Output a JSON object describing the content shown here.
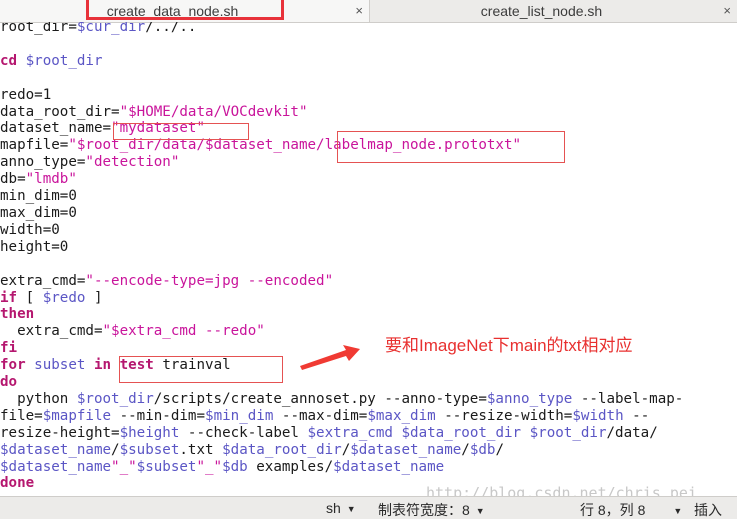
{
  "tabs": [
    {
      "label": "create_data_node.sh",
      "close": "×",
      "active": true
    },
    {
      "label": "create_list_node.sh",
      "close": "×",
      "active": false
    }
  ],
  "code": {
    "l1": {
      "a": "root_dir=",
      "b": "$cur_dir",
      "c": "/../.."
    },
    "l3": {
      "a": "cd ",
      "b": "$root_dir"
    },
    "l5": "redo=1",
    "l6": {
      "a": "data_root_dir=",
      "b": "\"$HOME/data/VOCdevkit\""
    },
    "l7": {
      "a": "dataset_name=",
      "b": "\"mydataset\""
    },
    "l8": {
      "a": "mapfile=",
      "b": "\"$root_dir/data/$dataset_name/labelmap_node.prototxt\""
    },
    "l9": {
      "a": "anno_type=",
      "b": "\"detection\""
    },
    "l10": {
      "a": "db=",
      "b": "\"lmdb\""
    },
    "l11": "min_dim=0",
    "l12": "max_dim=0",
    "l13": "width=0",
    "l14": "height=0",
    "l16": {
      "a": "extra_cmd=",
      "b": "\"--encode-type=jpg --encoded\""
    },
    "l17": {
      "a": "if",
      "b": " [ ",
      "c": "$redo",
      "d": " ]"
    },
    "l18": "then",
    "l19": {
      "a": "  extra_cmd=",
      "b": "\"$extra_cmd --redo\""
    },
    "l20": "fi",
    "l21": {
      "a": "for",
      "b": " subset ",
      "c": "in",
      "d": " ",
      "e": "test",
      "f": " trainval"
    },
    "l22": "do",
    "l23": {
      "a": "  python ",
      "b": "$root_dir",
      "c": "/scripts/create_annoset.py --anno-type=",
      "d": "$anno_type",
      "e": " --label-map-"
    },
    "l24": {
      "a": "file=",
      "b": "$mapfile",
      "c": " --min-dim=",
      "d": "$min_dim",
      "e": " --max-dim=",
      "f": "$max_dim",
      "g": " --resize-width=",
      "h": "$width",
      "i": " --"
    },
    "l25": {
      "a": "resize-height=",
      "b": "$height",
      "c": " --check-label ",
      "d": "$extra_cmd",
      "e": " ",
      "f": "$data_root_dir",
      "g": " ",
      "h": "$root_dir",
      "i": "/data/"
    },
    "l26": {
      "a": "$dataset_name",
      "b": "/",
      "c": "$subset",
      "d": ".txt ",
      "e": "$data_root_dir",
      "f": "/",
      "g": "$dataset_name",
      "h": "/",
      "i": "$db",
      "j": "/"
    },
    "l27": {
      "a": "$dataset_name",
      "b": "\"_\"",
      "c": "$subset",
      "d": "\"_\"",
      "e": "$db",
      "f": " examples/",
      "g": "$dataset_name"
    },
    "l28": "done"
  },
  "annotation": "要和ImageNet下main的txt相对应",
  "watermark": "http://blog.csdn.net/chris_pei",
  "status": {
    "language": "sh",
    "tab_width": "制表符宽度：8",
    "position": "行 8，列 8",
    "mode": "插入"
  },
  "colors": {
    "keyword": "#b5176f",
    "variable": "#5b56c5",
    "string": "#c9149b",
    "annotation": "#e8302f"
  }
}
